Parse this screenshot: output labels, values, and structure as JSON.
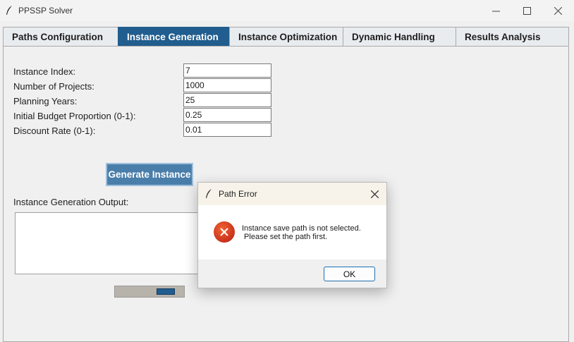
{
  "window": {
    "title": "PPSSP Solver"
  },
  "tabs": [
    {
      "label": "Paths Configuration"
    },
    {
      "label": "Instance Generation"
    },
    {
      "label": "Instance Optimization"
    },
    {
      "label": "Dynamic Handling"
    },
    {
      "label": "Results Analysis"
    }
  ],
  "form": {
    "instance_index": {
      "label": "Instance Index:",
      "value": "7"
    },
    "num_projects": {
      "label": "Number of Projects:",
      "value": "1000"
    },
    "planning_years": {
      "label": "Planning Years:",
      "value": "25"
    },
    "budget_proportion": {
      "label": "Initial Budget Proportion (0-1):",
      "value": "0.25"
    },
    "discount_rate": {
      "label": "Discount Rate (0-1):",
      "value": "0.01"
    }
  },
  "generate_button": {
    "label": "Generate Instance"
  },
  "output": {
    "label": "Instance Generation Output:"
  },
  "dialog": {
    "title": "Path Error",
    "message": "Instance save path is not selected.\n Please set the path first.",
    "ok_label": "OK"
  },
  "colors": {
    "accent": "#215d8e",
    "button": "#4a7eaa",
    "error": "#c42b1c"
  }
}
